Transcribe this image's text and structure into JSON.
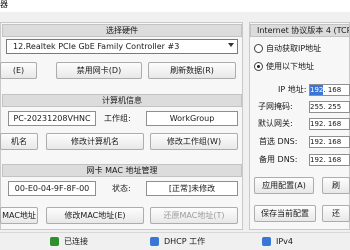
{
  "window": {
    "title": "器"
  },
  "adapter_section": {
    "header": "选择硬件",
    "selected_adapter": "12.Realtek PCIe GbE Family Controller #3",
    "btn_enable": "(E)",
    "btn_disable": "禁用网卡(D)",
    "btn_refresh": "刷新数据(R)"
  },
  "computer_section": {
    "header": "计算机信息",
    "computer_name": "PC-20231208VHNC",
    "workgroup_label": "工作组:",
    "workgroup": "WorkGroup",
    "btn_rename_partial": "机名",
    "btn_rename": "修改计算机名",
    "btn_workgroup": "修改工作组(W)"
  },
  "mac_section": {
    "header": "网卡 MAC 地址管理",
    "mac": "00-E0-04-9F-8F-00",
    "status_label": "状态:",
    "status_value": "[正常]未修改",
    "btn_partial": "MAC地址",
    "btn_modify": "修改MAC地址(E)",
    "btn_restore": "还原MAC地址(T)"
  },
  "ip_section": {
    "header": "Internet 协议版本 4 (TCP",
    "auto_label": "自动获取IP地址",
    "manual_label": "使用以下地址",
    "rows": [
      {
        "label": "IP 地址:",
        "seg1": "192",
        "seg2": ". 168",
        "seg1_selected": true
      },
      {
        "label": "子网掩码:",
        "seg1": "255",
        "seg2": ". 255"
      },
      {
        "label": "默认网关:",
        "seg1": "192",
        "seg2": ". 168"
      },
      {
        "label": "首选 DNS:",
        "seg1": "192",
        "seg2": ". 168"
      },
      {
        "label": "备用 DNS:",
        "seg1": "192",
        "seg2": ". 168"
      }
    ],
    "btn_apply": "应用配置(A)",
    "btn_save": "保存当前配置",
    "btn_right1": "刷",
    "btn_right2": "还"
  },
  "statusbar": {
    "connection": "已连接",
    "dhcp": "DHCP 工作",
    "ipv4": "IPv4",
    "colors": {
      "connected": "#2f8f2f",
      "dhcp": "#3a76d8",
      "ipv4": "#3a76d8"
    }
  }
}
